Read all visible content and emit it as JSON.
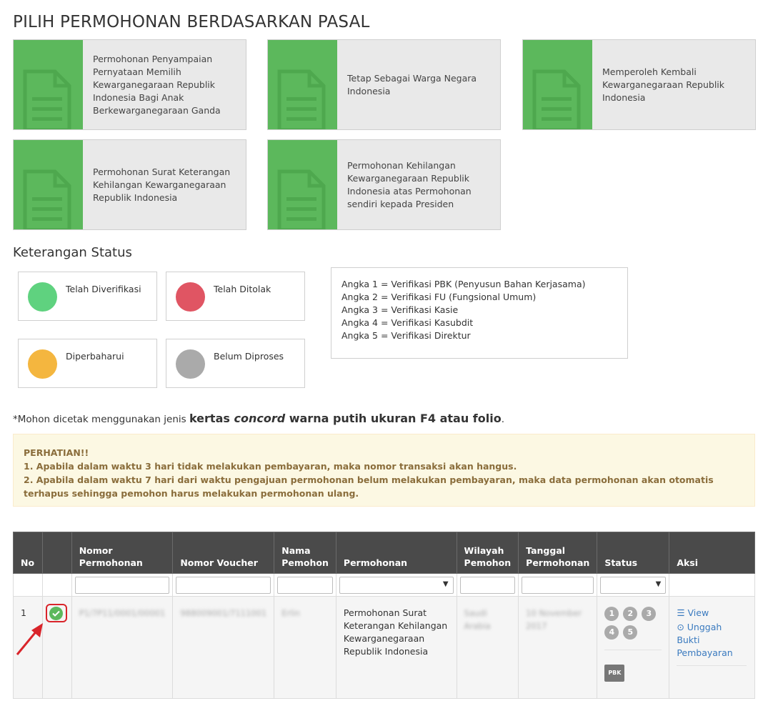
{
  "page": {
    "title": "PILIH PERMOHONAN BERDASARKAN PASAL"
  },
  "cards": [
    {
      "label": "Permohonan Penyampaian Pernyataan Memilih Kewarganegaraan Republik Indonesia Bagi Anak Berkewarganegaraan Ganda"
    },
    {
      "label": "Tetap Sebagai Warga Negara Indonesia"
    },
    {
      "label": "Memperoleh Kembali Kewarganegaraan Republik Indonesia"
    },
    {
      "label": "Permohonan Surat Keterangan Kehilangan Kewarganegaraan Republik Indonesia"
    },
    {
      "label": "Permohonan Kehilangan Kewarganegaraan Republik Indonesia atas Permohonan sendiri kepada Presiden"
    }
  ],
  "status_legend": {
    "title": "Keterangan Status",
    "items": [
      {
        "label": "Telah Diverifikasi",
        "color": "#5fd27f"
      },
      {
        "label": "Telah Ditolak",
        "color": "#e05563"
      },
      {
        "label": "Diperbaharui",
        "color": "#f4b63f"
      },
      {
        "label": "Belum Diproses",
        "color": "#aaaaaa"
      }
    ],
    "numbers": [
      "Angka 1 = Verifikasi PBK (Penyusun Bahan Kerjasama)",
      "Angka 2 = Verifikasi FU (Fungsional Umum)",
      "Angka 3 = Verifikasi Kasie",
      "Angka 4 = Verifikasi Kasubdit",
      "Angka 5 = Verifikasi Direktur"
    ]
  },
  "print_note": {
    "prefix": "*Mohon dicetak menggunakan jenis ",
    "bold1": "kertas ",
    "italic": "concord",
    "bold2": " warna putih ukuran F4 atau folio",
    "suffix": "."
  },
  "warning": {
    "title": "PERHATIAN!!",
    "line1": "1. Apabila dalam waktu 3 hari tidak melakukan pembayaran, maka nomor transaksi akan hangus.",
    "line2": "2. Apabila dalam waktu 7 hari dari waktu pengajuan permohonan belum melakukan pembayaran, maka data permohonan akan otomatis terhapus sehingga pemohon harus melakukan permohonan ulang."
  },
  "table": {
    "headers": {
      "no": "No",
      "check": "",
      "nomor_permohonan": "Nomor Permohonan",
      "nomor_voucher": "Nomor Voucher",
      "nama_pemohon": "Nama Pemohon",
      "permohonan": "Permohonan",
      "wilayah_pemohon": "Wilayah Pemohon",
      "tanggal_permohonan": "Tanggal Permohonan",
      "status": "Status",
      "aksi": "Aksi"
    },
    "rows": [
      {
        "no": "1",
        "nomor_permohonan": "P1/7P11/0001/00001",
        "nomor_voucher": "988009001/7111001",
        "nama_pemohon": "Erlin",
        "permohonan": "Permohonan Surat Keterangan Kehilangan Kewarganegaraan Republik Indonesia",
        "wilayah_pemohon": "Saudi Arabia",
        "tanggal_permohonan": "10 November 2017",
        "steps": [
          "1",
          "2",
          "3",
          "4",
          "5"
        ],
        "badge": "PBK",
        "view_label": "View",
        "upload_label": "Unggah Bukti Pembayaran"
      }
    ]
  },
  "colors": {
    "card_accent": "#5cb85c",
    "header_bg": "#4a4a4a",
    "warning_bg": "#fcf8e3",
    "warning_text": "#8a6d3b",
    "link": "#3a7abf",
    "annotation_red": "#d9242a"
  }
}
